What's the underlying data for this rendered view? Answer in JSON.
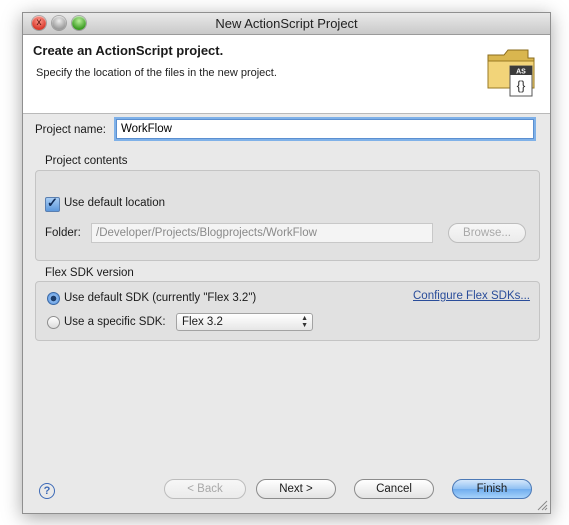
{
  "window": {
    "title": "New ActionScript Project"
  },
  "header": {
    "title": "Create an ActionScript project.",
    "description": "Specify the location of the files in the new project.",
    "icon_badge": "AS",
    "icon_braces": "{}"
  },
  "project_name": {
    "label": "Project name:",
    "value": "WorkFlow"
  },
  "project_contents": {
    "group_label": "Project contents",
    "use_default_location": {
      "label": "Use default location",
      "checked": true
    },
    "folder_label": "Folder:",
    "folder_value": "/Developer/Projects/Blogprojects/WorkFlow",
    "browse_label": "Browse..."
  },
  "flex_sdk": {
    "group_label": "Flex SDK version",
    "use_default": {
      "label": "Use default SDK (currently \"Flex 3.2\")",
      "selected": true
    },
    "use_specific": {
      "label": "Use a specific SDK:",
      "selected": false
    },
    "configure_link": "Configure Flex SDKs...",
    "sdk_select": "Flex 3.2"
  },
  "footer": {
    "help": "?",
    "back_label": "< Back",
    "next_label": "Next >",
    "cancel_label": "Cancel",
    "finish_label": "Finish"
  },
  "colors": {
    "accent": "#70adee",
    "focus_ring": "#7fb1e8",
    "link": "#2a4d9a"
  },
  "icons": {
    "close": "close-icon",
    "minimize": "minimize-icon",
    "zoom": "zoom-icon",
    "folder": "folder-as-icon",
    "help": "help-icon",
    "resize": "resize-grip-icon"
  }
}
